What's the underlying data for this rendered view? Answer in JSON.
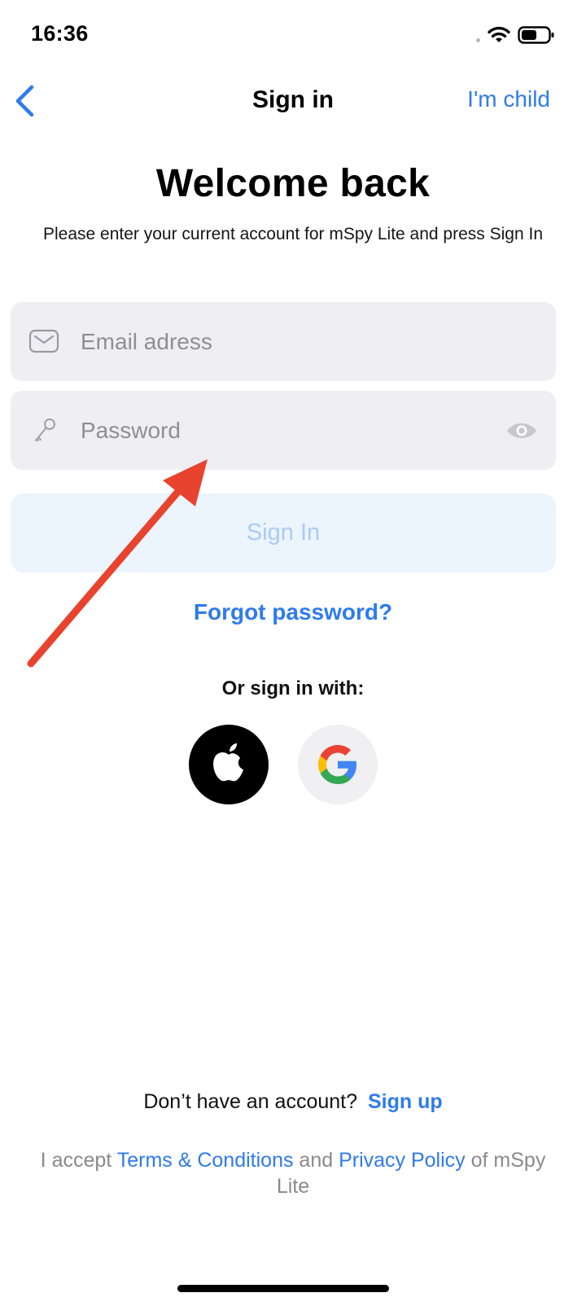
{
  "status_bar": {
    "time": "16:36"
  },
  "nav": {
    "title": "Sign in",
    "child_link": "I'm child"
  },
  "heading": {
    "title": "Welcome back",
    "subtitle": "Please enter your current account for mSpy Lite and press Sign In"
  },
  "form": {
    "email_placeholder": "Email adress",
    "password_placeholder": "Password",
    "submit_label": "Sign In",
    "forgot_label": "Forgot password?"
  },
  "social": {
    "label": "Or sign in with:",
    "providers": [
      "apple-icon",
      "google-icon"
    ]
  },
  "footer": {
    "no_account": "Don’t have an account?",
    "signup": "Sign up",
    "terms_prefix": "I accept ",
    "terms_link": "Terms & Conditions",
    "terms_and": " and ",
    "privacy_link": "Privacy Policy",
    "terms_suffix": " of mSpy Lite"
  },
  "colors": {
    "accent": "#2f7bec",
    "field_bg": "#efeff3",
    "button_disabled_bg": "#ecf4fe",
    "button_disabled_text": "#a8ccf6",
    "annotation_arrow": "#e8432f"
  }
}
